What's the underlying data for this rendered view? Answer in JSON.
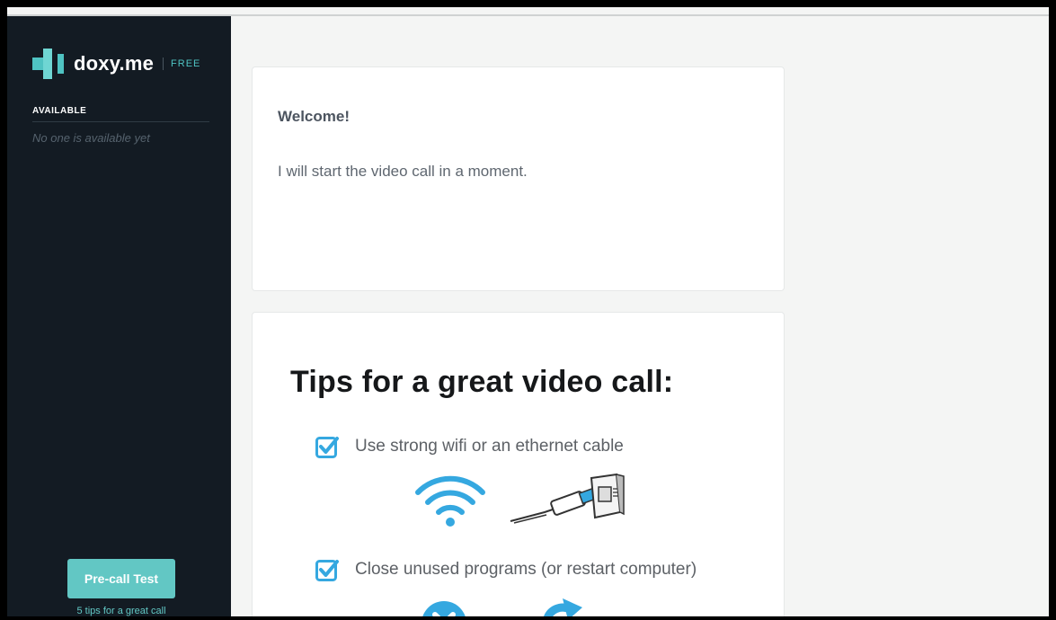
{
  "brand": {
    "name": "doxy.me",
    "plan": "FREE",
    "accent": "#4fc3c2"
  },
  "sidebar": {
    "available_label": "AVAILABLE",
    "empty_text": "No one is available yet",
    "precall_button": "Pre-call Test",
    "tips_link": "5 tips for a great call"
  },
  "welcome": {
    "title": "Welcome!",
    "message": "I will start the video call in a moment."
  },
  "tips": {
    "heading": "Tips for a great video call:",
    "items": [
      {
        "text": "Use strong wifi or an ethernet cable",
        "icons": [
          "wifi-icon",
          "ethernet-cable-icon"
        ]
      },
      {
        "text": "Close unused programs (or restart computer)",
        "icons": [
          "close-programs-icon",
          "restart-icon"
        ]
      }
    ]
  }
}
